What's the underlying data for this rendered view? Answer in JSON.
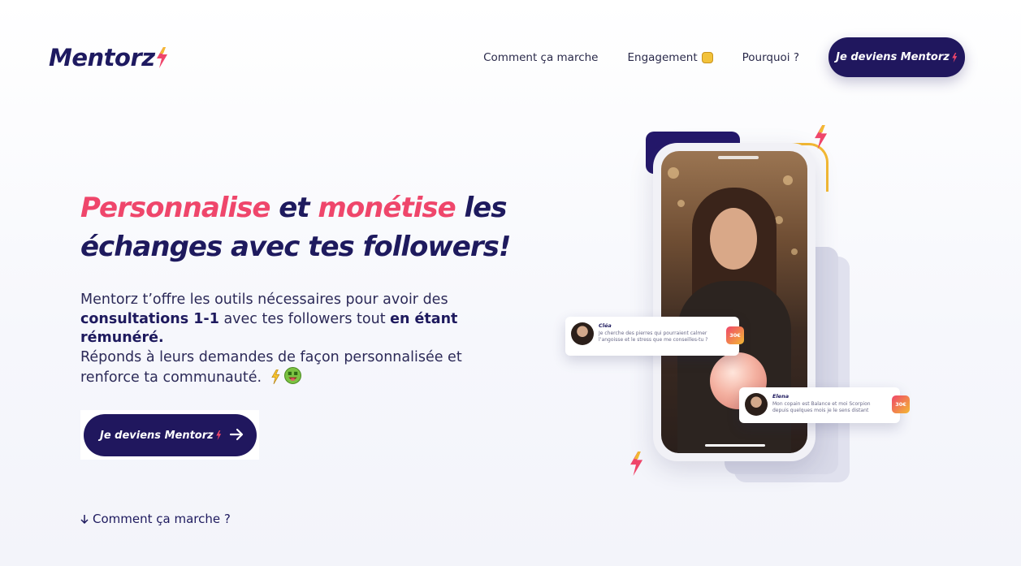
{
  "header": {
    "logo_text": "Mentorz",
    "nav": [
      {
        "label": "Comment ça marche"
      },
      {
        "label": "Engagement"
      },
      {
        "label": "Pourquoi ?"
      }
    ],
    "cta_label": "Je deviens Mentorz"
  },
  "hero": {
    "title_word1": "Personnalise",
    "title_word2": " et ",
    "title_word3": "monétise",
    "title_word4": " les",
    "title_line2": "échanges avec tes followers!",
    "desc_part1": "Mentorz t’offre les outils nécessaires pour avoir des ",
    "desc_bold1": "consultations 1-1",
    "desc_part2": " avec tes followers tout ",
    "desc_bold2": "en étant rémunéré.",
    "desc_part3": "Réponds à leurs demandes de façon personnalisée et renforce ta communauté.",
    "cta_label": "Je deviens Mentorz",
    "how_link": "Comment ça marche ?"
  },
  "illustration": {
    "bubble1": {
      "name": "Cléa",
      "text": "Je cherche des pierres qui pourraient calmer l’angoisse et le stress que me conseilles-tu ?",
      "price": "30€"
    },
    "bubble2": {
      "name": "Elena",
      "text": "Mon copain est Balance et moi Scorpion depuis quelques mois je le sens distant",
      "price": "30€"
    }
  },
  "colors": {
    "navy": "#20175e",
    "pink": "#ef466b",
    "orange": "#f3b933"
  }
}
